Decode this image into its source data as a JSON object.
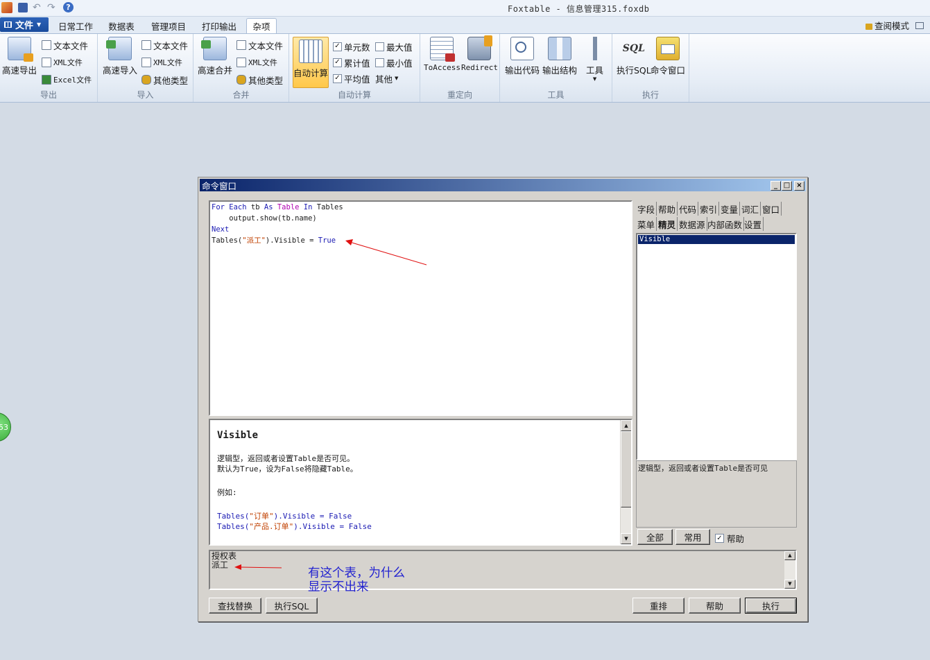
{
  "app": {
    "title": "Foxtable - 信息管理315.foxdb",
    "view_mode": "查阅模式"
  },
  "ribbon": {
    "file_menu": "文件",
    "tabs": [
      "日常工作",
      "数据表",
      "管理项目",
      "打印输出",
      "杂项"
    ],
    "active_tab": "杂项",
    "groups": {
      "export": {
        "label": "导出",
        "big": "高速导出",
        "items": [
          "文本文件",
          "XML文件",
          "Excel文件"
        ]
      },
      "import": {
        "label": "导入",
        "big": "高速导入",
        "items": [
          "文本文件",
          "XML文件",
          "其他类型"
        ]
      },
      "merge": {
        "label": "合并",
        "big": "高速合并",
        "items": [
          "文本文件",
          "XML文件",
          "其他类型"
        ]
      },
      "autocalc": {
        "label": "自动计算",
        "big": "自动计算",
        "checks": [
          "单元数",
          "累计值",
          "平均值"
        ],
        "checks2": [
          "最大值",
          "最小值"
        ],
        "other": "其他"
      },
      "redirect": {
        "label": "重定向",
        "btn1": "ToAccess",
        "btn2": "Redirect"
      },
      "tools": {
        "label": "工具",
        "btn1": "输出代码",
        "btn2": "输出结构",
        "btn3": "工具"
      },
      "exec": {
        "label": "执行",
        "btn1": "执行SQL",
        "btn2": "命令窗口",
        "sql_badge": "SQL"
      }
    }
  },
  "badge": {
    "text": "53"
  },
  "command_window": {
    "title": "命令窗口",
    "code": {
      "l1": {
        "k1": "For Each",
        "t1": " tb ",
        "k2": "As",
        "t2": " ",
        "k3": "Table",
        "t3": " ",
        "k4": "In",
        "t4": " Tables"
      },
      "l2": "    output.show(tb.name)",
      "l3": "Next",
      "l4": {
        "a": "Tables(",
        "s": "\"派工\"",
        "b": ").Visible = ",
        "v": "True"
      }
    },
    "help": {
      "title": "Visible",
      "line1": "逻辑型，返回或者设置Table是否可见。",
      "line2": "默认为True，设为False将隐藏Table。",
      "line3": "例如:",
      "ex1": {
        "a": "Tables(",
        "s": "\"订单\"",
        "b": ").Visible = ",
        "v": "False"
      },
      "ex2": {
        "a": "Tables(",
        "s": "\"产品.订单\"",
        "b": ").Visible = ",
        "v": "False"
      }
    },
    "right_tabs_row1": [
      "字段",
      "帮助",
      "代码",
      "索引",
      "变量",
      "词汇",
      "窗口"
    ],
    "right_tabs_row2": [
      "菜单",
      "精灵",
      "数据源",
      "内部函数",
      "设置"
    ],
    "selected_right_tab": "精灵",
    "list_selected": "Visible",
    "description": "逻辑型，返回或者设置Table是否可见",
    "buttons": {
      "all": "全部",
      "common": "常用",
      "help_check": "帮助",
      "find_replace": "查找替换",
      "exec_sql": "执行SQL",
      "reset": "重排",
      "help": "帮助",
      "execute": "执行"
    },
    "output": [
      "授权表",
      "派工"
    ]
  },
  "annotation": {
    "line1": "有这个表，为什么",
    "line2": "显示不出来",
    "color": "#2323d0"
  }
}
